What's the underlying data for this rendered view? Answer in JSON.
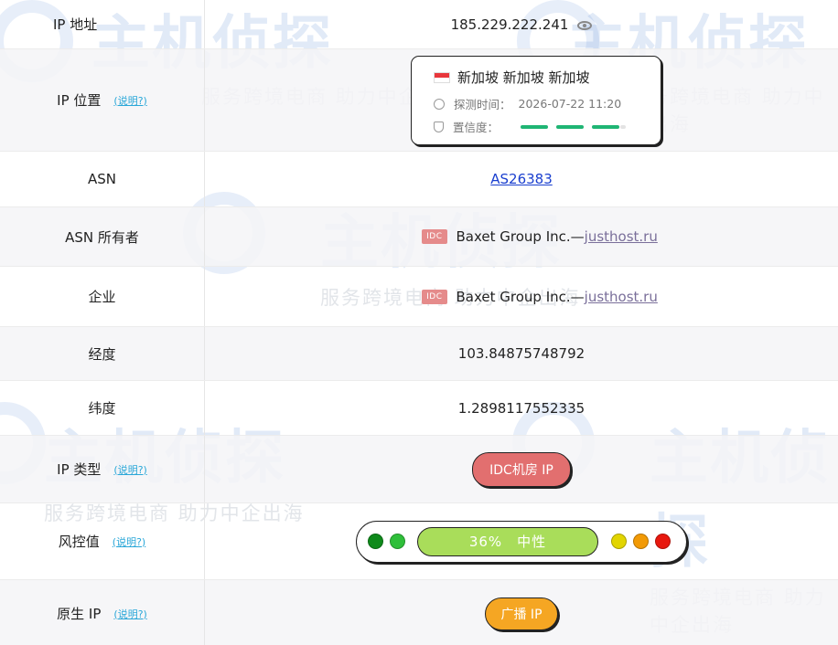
{
  "watermark": {
    "logo_text": "主机侦探",
    "slogan": "服务跨境电商 助力中企出海"
  },
  "rows": {
    "ip_address": {
      "label": "IP 地址",
      "value": "185.229.222.241",
      "icon": "eye-icon"
    },
    "ip_location": {
      "label": "IP 位置",
      "help": "(说明?)",
      "flag": "singapore-flag",
      "location": "新加坡 新加坡 新加坡",
      "detect_label": "探测时间：",
      "detect_time": "2026-07-22 11:20",
      "confidence_label": "置信度：",
      "confidence_level": 0.9
    },
    "asn": {
      "label": "ASN",
      "value": "AS26383"
    },
    "asn_owner": {
      "label": "ASN 所有者",
      "badge": "IDC",
      "org": "Baxet Group Inc.—",
      "domain": "justhost.ru"
    },
    "company": {
      "label": "企业",
      "badge": "IDC",
      "org": "Baxet Group Inc.—",
      "domain": "justhost.ru"
    },
    "longitude": {
      "label": "经度",
      "value": "103.84875748792"
    },
    "latitude": {
      "label": "纬度",
      "value": "1.2898117552335"
    },
    "ip_type": {
      "label": "IP 类型",
      "help": "(说明?)",
      "value": "IDC机房 IP"
    },
    "risk": {
      "label": "风控值",
      "help": "(说明?)",
      "percent": "36%",
      "level": "中性",
      "colors": {
        "green_dark": "#0f8a1b",
        "green": "#2fbf3a",
        "bar": "#a9dd5a",
        "yellow": "#e2d500",
        "orange": "#f29a05",
        "red": "#e8180e"
      }
    },
    "native_ip": {
      "label": "原生 IP",
      "help": "(说明?)",
      "value": "广播 IP"
    }
  }
}
